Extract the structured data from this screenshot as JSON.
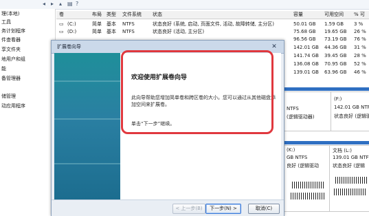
{
  "toolbar": {
    "icons": [
      "back-icon",
      "forward-icon",
      "up-icon",
      "properties-icon",
      "help-icon"
    ]
  },
  "left_tree": {
    "items": [
      "理(本地)",
      "工具",
      "务计划程序",
      "件查看器",
      "享文件夹",
      "地用户和组",
      "能",
      "备管理器",
      "",
      "储管理",
      "动应用程序"
    ]
  },
  "volume_table": {
    "headers": [
      "卷",
      "布局",
      "类型",
      "文件系统",
      "状态",
      "容量",
      "可用空间",
      "% 可"
    ],
    "rows": [
      {
        "vol": "(C:)",
        "layout": "简单",
        "type": "基本",
        "fs": "NTFS",
        "status": "状态良好 (系统, 启动, 页面文件, 活动, 故障转储, 主分区)",
        "capacity": "50.01 GB",
        "free": "1.59 GB",
        "pct": "3 %"
      },
      {
        "vol": "(D:)",
        "layout": "简单",
        "type": "基本",
        "fs": "NTFS",
        "status": "状态良好 (活动, 主分区)",
        "capacity": "75.68 GB",
        "free": "19.65 GB",
        "pct": "26 %"
      },
      {
        "vol": "",
        "layout": "",
        "type": "",
        "fs": "",
        "status": "",
        "capacity": "96.56 GB",
        "free": "73.19 GB",
        "pct": "76 %"
      },
      {
        "vol": "",
        "layout": "",
        "type": "",
        "fs": "",
        "status": "",
        "capacity": "142.01 GB",
        "free": "44.36 GB",
        "pct": "31 %"
      },
      {
        "vol": "",
        "layout": "",
        "type": "",
        "fs": "",
        "status": "",
        "capacity": "141.74 GB",
        "free": "39.45 GB",
        "pct": "28 %"
      },
      {
        "vol": "",
        "layout": "",
        "type": "",
        "fs": "",
        "status": "",
        "capacity": "136.08 GB",
        "free": "70.95 GB",
        "pct": "52 %"
      },
      {
        "vol": "",
        "layout": "",
        "type": "",
        "fs": "",
        "status": "",
        "capacity": "139.01 GB",
        "free": "63.96 GB",
        "pct": "46 %"
      }
    ]
  },
  "disk_panel": {
    "upper_left": {
      "line1": "NTFS",
      "line2": "(逻辑驱动器)"
    },
    "upper_right": {
      "line1": "(F:)",
      "line2": "142.01 GB NTFS",
      "line3": "状态良好 (逻辑驱"
    },
    "lower_left": {
      "line1": "(K:)",
      "line2": "GB NTFS",
      "line3": "良好 (逻辑驱动"
    },
    "lower_right": {
      "line1": "文档 (L:)",
      "line2": "139.01 GB NTFS",
      "line3": "状态良好 (逻辑"
    }
  },
  "wizard": {
    "title": "扩展卷向导",
    "close_glyph": "✕",
    "heading": "欢迎使用扩展卷向导",
    "description": "此向导帮助您增加简单卷和跨区卷的大小。您可以通过从其他磁盘添加空间来扩展卷。",
    "next_hint": "单击“下一步”继续。",
    "back_label": "< 上一步(B)",
    "next_label": "下一步(N) >",
    "cancel_label": "取消(C)"
  },
  "colors": {
    "highlight": "#e0383e",
    "disk_bar": "#2f6fc2",
    "wizard_side": "#1f8f9a"
  }
}
